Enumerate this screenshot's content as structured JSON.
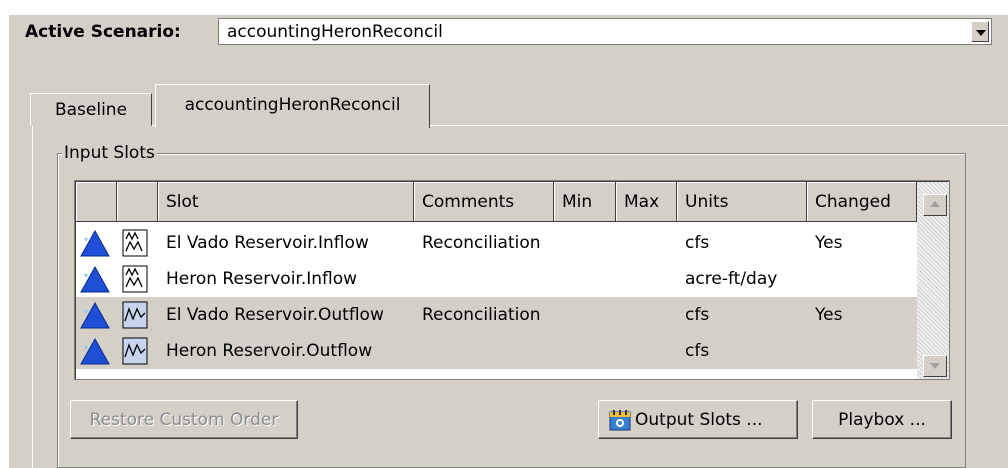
{
  "scenario": {
    "label": "Active Scenario:",
    "value": "accountingHeronReconcil"
  },
  "tabs": [
    {
      "label": "Baseline",
      "selected": false
    },
    {
      "label": "accountingHeronReconcil",
      "selected": true
    }
  ],
  "group": {
    "title": "Input Slots"
  },
  "table": {
    "columns": [
      "",
      "",
      "Slot",
      "Comments",
      "Min",
      "Max",
      "Units",
      "Changed"
    ],
    "rows": [
      {
        "slot": "El Vado Reservoir.Inflow",
        "comments": "Reconciliation",
        "min": "",
        "max": "",
        "units": "cfs",
        "changed": "Yes",
        "icon": "inflow-slot-icon",
        "highlight": false
      },
      {
        "slot": "Heron Reservoir.Inflow",
        "comments": "",
        "min": "",
        "max": "",
        "units": "acre-ft/day",
        "changed": "",
        "icon": "inflow-slot-icon",
        "highlight": false
      },
      {
        "slot": "El Vado Reservoir.Outflow",
        "comments": "Reconciliation",
        "min": "",
        "max": "",
        "units": "cfs",
        "changed": "Yes",
        "icon": "outflow-slot-icon",
        "highlight": true
      },
      {
        "slot": "Heron Reservoir.Outflow",
        "comments": "",
        "min": "",
        "max": "",
        "units": "cfs",
        "changed": "",
        "icon": "outflow-slot-icon",
        "highlight": true
      }
    ]
  },
  "buttons": {
    "restore": "Restore Custom Order",
    "output": "Output Slots ...",
    "playbox": "Playbox ..."
  },
  "colors": {
    "triangle": "#1f4fd6",
    "panel": "#d4d0c8"
  },
  "icons": {
    "row_object": "reservoir-triangle-icon",
    "output": "calendar-icon"
  }
}
